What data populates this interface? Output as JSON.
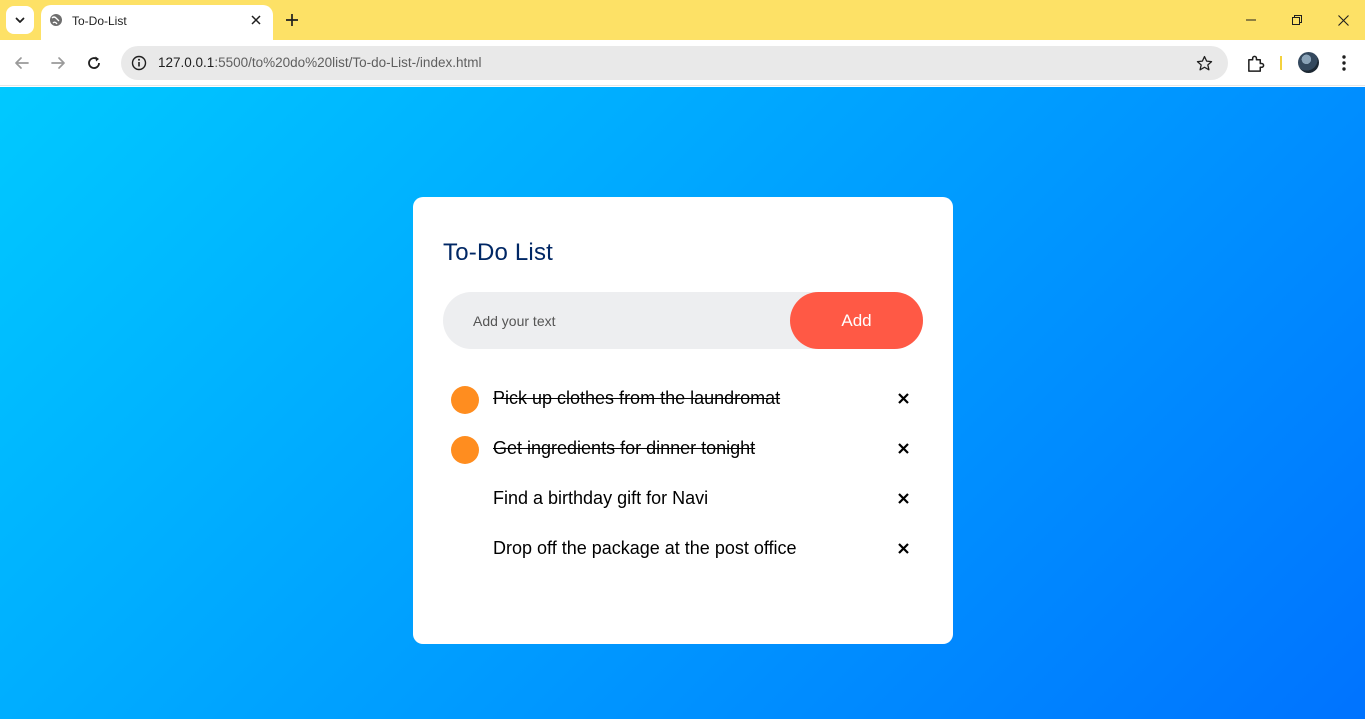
{
  "browser": {
    "tab_title": "To-Do-List",
    "url_host": "127.0.0.1",
    "url_rest": ":5500/to%20do%20list/To-do-List-/index.html"
  },
  "app": {
    "title": "To-Do List",
    "input_placeholder": "Add your text",
    "add_label": "Add",
    "tasks": [
      {
        "text": "Pick up clothes from the laundromat",
        "done": true
      },
      {
        "text": "Get ingredients for dinner tonight",
        "done": true
      },
      {
        "text": "Find a birthday gift for Navi",
        "done": false
      },
      {
        "text": "Drop off the package at the post office",
        "done": false
      }
    ],
    "delete_glyph": "×"
  },
  "colors": {
    "gradient_start": "#00c9ff",
    "gradient_end": "#0073ff",
    "add_button": "#ff5945",
    "check_done": "#ff8d1f",
    "title": "#002765"
  }
}
